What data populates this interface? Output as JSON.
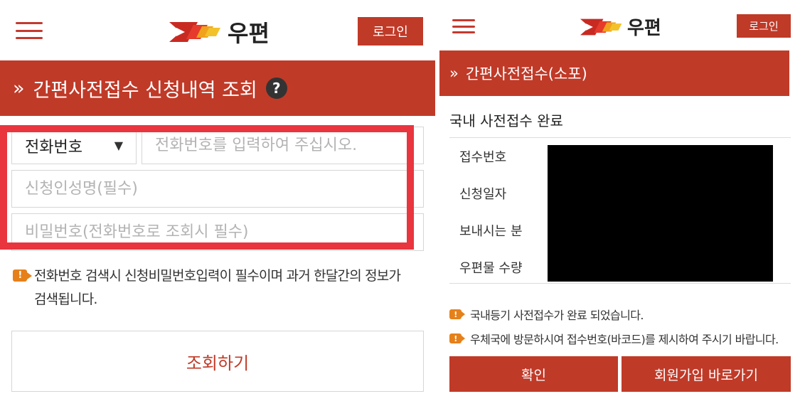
{
  "left": {
    "header": {
      "logo_text": "우편",
      "login_label": "로그인"
    },
    "title": {
      "chevron": "»",
      "text": "간편사전접수 신청내역 조회",
      "help": "?"
    },
    "form": {
      "select_value": "전화번호",
      "select_arrow": "▼",
      "phone_placeholder": "전화번호를 입력하여 주십시오.",
      "name_placeholder": "신청인성명(필수)",
      "password_placeholder": "비밀번호(전화번호로 조회시 필수)"
    },
    "notice": {
      "line1": "전화번호 검색시 신청비밀번호입력이 필수이며 과거 한달간의 정보가",
      "line2": "검색됩니다."
    },
    "search_label": "조회하기"
  },
  "right": {
    "header": {
      "logo_text": "우편",
      "login_label": "로그인"
    },
    "title": {
      "chevron": "»",
      "text": "간편사전접수(소포)"
    },
    "section_title": "국내 사전접수 완료",
    "info_labels": [
      "접수번호",
      "신청일자",
      "보내시는 분",
      "우편물 수량"
    ],
    "notices": [
      "국내등기 사전접수가 완료 되었습니다.",
      "우체국에 방문하시여 접수번호(바코드)를 제시하여 주시기 바랍니다."
    ],
    "buttons": {
      "confirm": "확인",
      "signup": "회원가입 바로가기"
    }
  },
  "notice_icon": "!",
  "colors": {
    "brand_red": "#c03a28",
    "highlight": "#e8353e",
    "notice_orange": "#e6801a"
  }
}
